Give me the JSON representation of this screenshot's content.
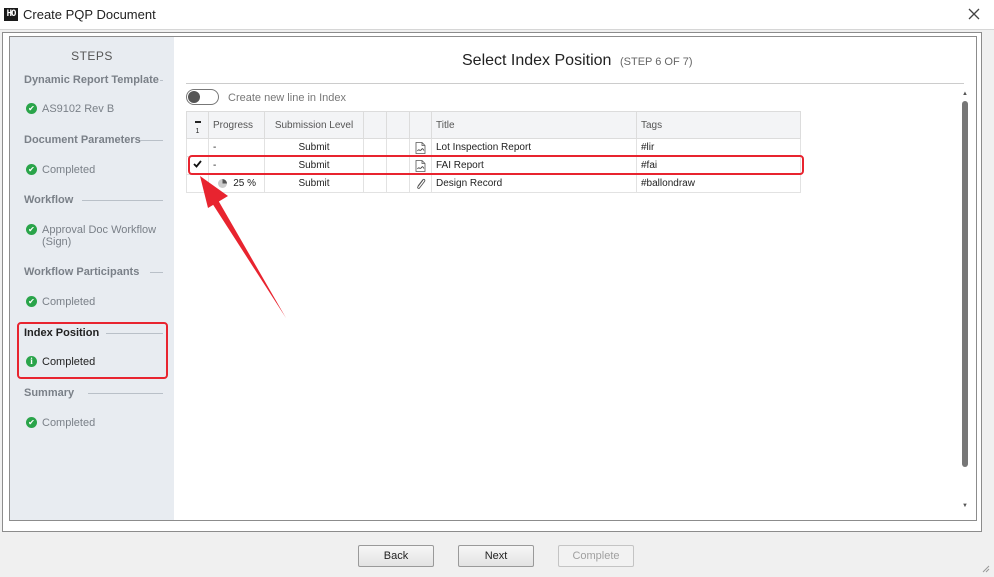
{
  "window": {
    "app_icon_text": "HO",
    "title": "Create PQP Document"
  },
  "sidebar": {
    "header": "STEPS",
    "steps": [
      {
        "title": "Dynamic Report Template",
        "status": "AS9102 Rev B",
        "icon": "check-circle-icon"
      },
      {
        "title": "Document Parameters",
        "status": "Completed",
        "icon": "check-circle-icon"
      },
      {
        "title": "Workflow",
        "status": "Approval Doc Workflow (Sign)",
        "icon": "check-circle-icon"
      },
      {
        "title": "Workflow Participants",
        "status": "Completed",
        "icon": "check-circle-icon"
      },
      {
        "title": "Index Position",
        "status": "Completed",
        "icon": "info-circle-icon",
        "active": true
      },
      {
        "title": "Summary",
        "status": "Completed",
        "icon": "check-circle-icon"
      }
    ],
    "status_color": "#2aa44a"
  },
  "main": {
    "title": "Select Index Position",
    "step_indicator": "(STEP 6 OF 7)",
    "toggle_label": "Create new line in Index",
    "toggle_on": false,
    "table": {
      "selected_count": "1",
      "headers": [
        "Progress",
        "Submission Level",
        "",
        "",
        "",
        "Title",
        "Tags"
      ],
      "rows": [
        {
          "selected": false,
          "progress": "-",
          "submission_level": "Submit",
          "icon": "document-signature-icon",
          "title": "Lot Inspection Report",
          "tags": "#lir"
        },
        {
          "selected": true,
          "progress": "-",
          "submission_level": "Submit",
          "icon": "document-signature-icon",
          "title": "FAI Report",
          "tags": "#fai"
        },
        {
          "selected": false,
          "progress": "25 %",
          "progress_icon": "pie-chart-icon",
          "submission_level": "Submit",
          "icon": "paperclip-icon",
          "title": "Design Record",
          "tags": "#ballondraw"
        }
      ]
    }
  },
  "footer": {
    "back_label": "Back",
    "next_label": "Next",
    "complete_label": "Complete",
    "complete_enabled": false
  },
  "annotation_color": "#e8242f"
}
